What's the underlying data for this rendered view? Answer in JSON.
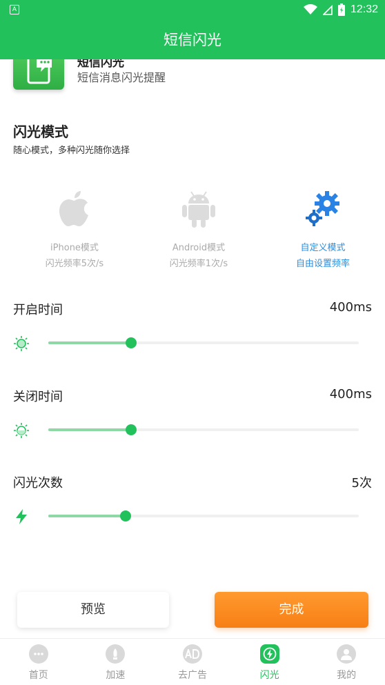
{
  "status_bar": {
    "left_icon": "A",
    "time": "12:32"
  },
  "app_bar": {
    "title": "短信闪光"
  },
  "card": {
    "name": "短信闪光",
    "subtitle": "短信消息闪光提醒"
  },
  "flash_mode": {
    "title": "闪光模式",
    "subtitle": "随心模式，多种闪光随你选择",
    "options": [
      {
        "label": "iPhone模式",
        "desc": "闪光频率5次/s",
        "icon": "apple-icon"
      },
      {
        "label": "Android模式",
        "desc": "闪光频率1次/s",
        "icon": "android-icon"
      },
      {
        "label": "自定义模式",
        "desc": "自由设置频率",
        "icon": "gears-icon",
        "selected": true
      }
    ]
  },
  "settings": [
    {
      "label": "开启时间",
      "value": "400ms",
      "icon": "sun-icon",
      "fraction": 0.267
    },
    {
      "label": "关闭时间",
      "value": "400ms",
      "icon": "sun-dim-icon",
      "fraction": 0.267
    },
    {
      "label": "闪光次数",
      "value": "5次",
      "icon": "lightning-icon",
      "fraction": 0.249
    }
  ],
  "buttons": {
    "preview": "预览",
    "done": "完成"
  },
  "tabs": [
    {
      "label": "首页",
      "icon": "chat-icon"
    },
    {
      "label": "加速",
      "icon": "rocket-icon"
    },
    {
      "label": "去广告",
      "icon": "ad-icon"
    },
    {
      "label": "闪光",
      "icon": "flash-icon",
      "active": true
    },
    {
      "label": "我的",
      "icon": "user-icon"
    }
  ],
  "colors": {
    "primary": "#23c15c",
    "accent_orange": "#f77f15",
    "selected_blue": "#2a8fe0"
  }
}
